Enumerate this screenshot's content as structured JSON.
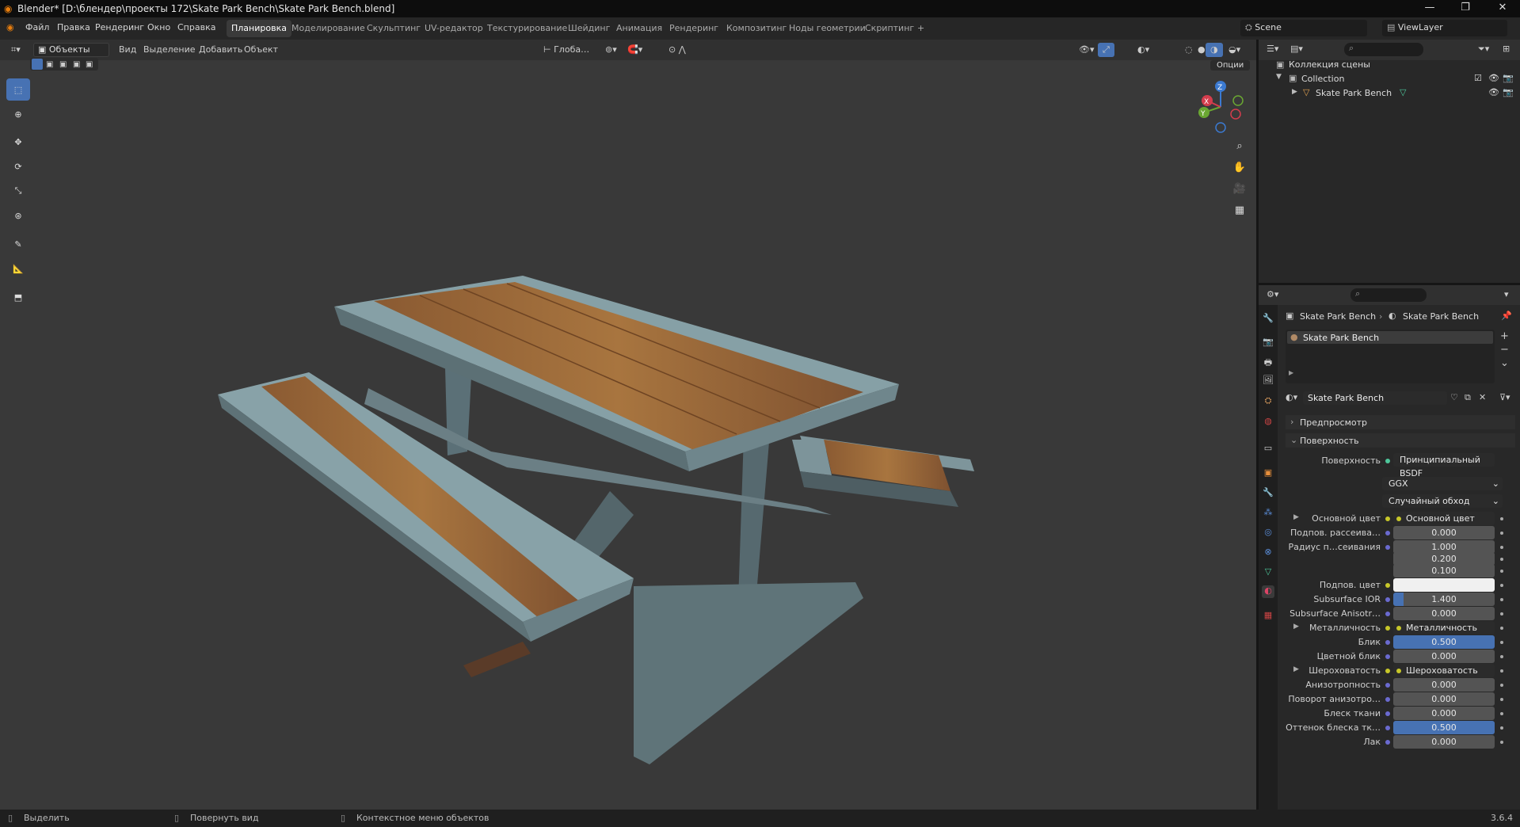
{
  "window": {
    "title": "Blender* [D:\\блендер\\проекты 172\\Skate Park Bench\\Skate Park Bench.blend]",
    "minimize": "—",
    "maximize": "❐",
    "close": "✕"
  },
  "menus": [
    "Файл",
    "Правка",
    "Рендеринг",
    "Окно",
    "Справка"
  ],
  "workspaces": [
    "Планировка",
    "Моделирование",
    "Скульптинг",
    "UV-редактор",
    "Текстурирование",
    "Шейдинг",
    "Анимация",
    "Рендеринг",
    "Композитинг",
    "Ноды геометрии",
    "Скриптинг",
    "+"
  ],
  "active_workspace": "Планировка",
  "scene": "Scene",
  "viewlayer": "ViewLayer",
  "viewport": {
    "mode": "Объекты",
    "menus": [
      "Вид",
      "Выделение",
      "Добавить",
      "Объект"
    ],
    "orientation": "Глоба…",
    "options": "Опции",
    "gizmo": {
      "z": "Z",
      "y": "Y",
      "x": "X"
    }
  },
  "outliner": {
    "scene_collection": "Коллекция сцены",
    "collection": "Collection",
    "object": "Skate Park Bench"
  },
  "properties": {
    "breadcrumb_object": "Skate Park Bench",
    "breadcrumb_material": "Skate Park Bench",
    "slot": "Skate Park Bench",
    "material_name": "Skate Park Bench",
    "sections": {
      "preview": "Предпросмотр",
      "surface": "Поверхность"
    },
    "surface_label": "Поверхность",
    "surface_value": "Принципиальный BSDF",
    "distribution": "GGX",
    "subsurface_method": "Случайный обход",
    "rows": [
      {
        "label": "Основной цвет",
        "value": "Основной цвет",
        "kind": "link",
        "expand": true
      },
      {
        "label": "Подпов. рассеива…",
        "value": "0.000",
        "kind": "num"
      },
      {
        "label": "Радиус п…сеивания",
        "value": "1.000",
        "kind": "num"
      },
      {
        "label": "",
        "value": "0.200",
        "kind": "num"
      },
      {
        "label": "",
        "value": "0.100",
        "kind": "num"
      },
      {
        "label": "Подпов. цвет",
        "value": "",
        "kind": "color"
      },
      {
        "label": "Subsurface IOR",
        "value": "1.400",
        "kind": "num",
        "fill": 0.1
      },
      {
        "label": "Subsurface Anisotr…",
        "value": "0.000",
        "kind": "num"
      },
      {
        "label": "Металличность",
        "value": "Металличность",
        "kind": "link",
        "expand": true
      },
      {
        "label": "Блик",
        "value": "0.500",
        "kind": "num",
        "fill": 1.0
      },
      {
        "label": "Цветной блик",
        "value": "0.000",
        "kind": "num"
      },
      {
        "label": "Шероховатость",
        "value": "Шероховатость",
        "kind": "link",
        "expand": true
      },
      {
        "label": "Анизотропность",
        "value": "0.000",
        "kind": "num"
      },
      {
        "label": "Поворот анизотро…",
        "value": "0.000",
        "kind": "num"
      },
      {
        "label": "Блеск ткани",
        "value": "0.000",
        "kind": "num"
      },
      {
        "label": "Оттенок блеска тк…",
        "value": "0.500",
        "kind": "num",
        "fill": 1.0
      },
      {
        "label": "Лак",
        "value": "0.000",
        "kind": "num"
      }
    ]
  },
  "status": {
    "select": "Выделить",
    "rotate": "Повернуть вид",
    "context": "Контекстное меню объектов",
    "version": "3.6.4"
  },
  "colors": {
    "accent": "#4772b3",
    "orange": "#e87d0d",
    "bg": "#393939"
  }
}
